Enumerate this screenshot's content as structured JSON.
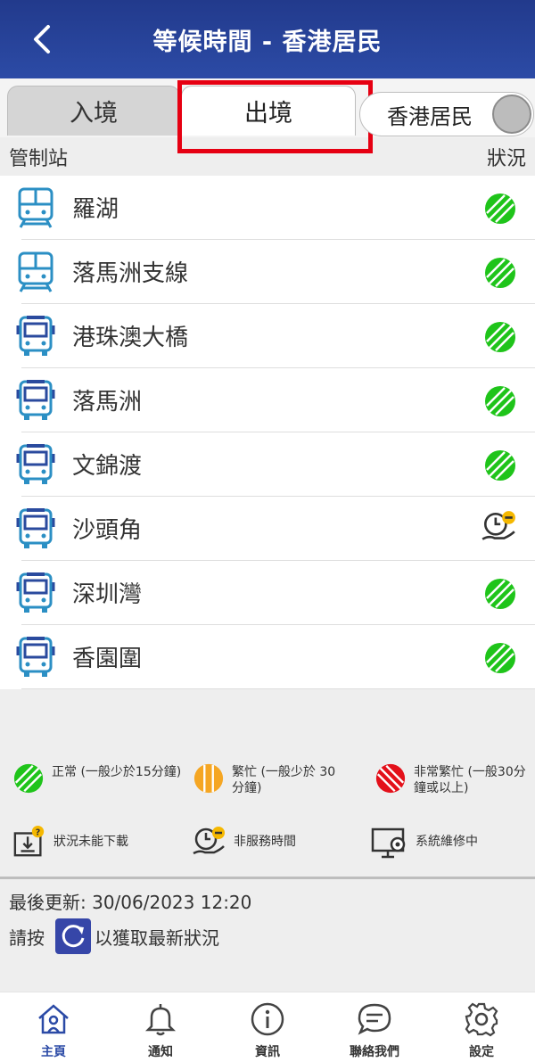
{
  "header": {
    "title": "等候時間 - 香港居民"
  },
  "tabs": {
    "entry": "入境",
    "exit": "出境"
  },
  "toggle": {
    "label": "香港居民"
  },
  "columns": {
    "station": "管制站",
    "status": "狀況"
  },
  "stations": [
    {
      "name": "羅湖",
      "icon": "train-icon",
      "status": "normal"
    },
    {
      "name": "落馬洲支線",
      "icon": "train-icon",
      "status": "normal"
    },
    {
      "name": "港珠澳大橋",
      "icon": "bus-icon",
      "status": "normal"
    },
    {
      "name": "落馬洲",
      "icon": "bus-icon",
      "status": "normal"
    },
    {
      "name": "文錦渡",
      "icon": "bus-icon",
      "status": "normal"
    },
    {
      "name": "沙頭角",
      "icon": "bus-icon",
      "status": "non-service-hours"
    },
    {
      "name": "深圳灣",
      "icon": "bus-icon",
      "status": "normal"
    },
    {
      "name": "香園圍",
      "icon": "bus-icon",
      "status": "normal"
    }
  ],
  "legend": {
    "normal": "正常 (一般少於15分鐘)",
    "busy": "繁忙 (一般少於 30分鐘)",
    "very_busy": "非常繁忙 (一般30分鐘或以上)",
    "not_downloaded": "狀況未能下載",
    "non_service": "非服務時間",
    "maintenance": "系統維修中"
  },
  "update": {
    "label": "最後更新:",
    "time": "30/06/2023 12:20"
  },
  "refresh": {
    "prefix": "請按",
    "suffix": "以獲取最新狀況"
  },
  "nav": {
    "home": "主頁",
    "notify": "通知",
    "info": "資訊",
    "contact": "聯絡我們",
    "settings": "設定"
  },
  "colors": {
    "header": "#2c4ba6",
    "normal": "#1fc41a",
    "busy": "#f5a623",
    "very_busy": "#e3101a",
    "highlight": "#e60012"
  }
}
